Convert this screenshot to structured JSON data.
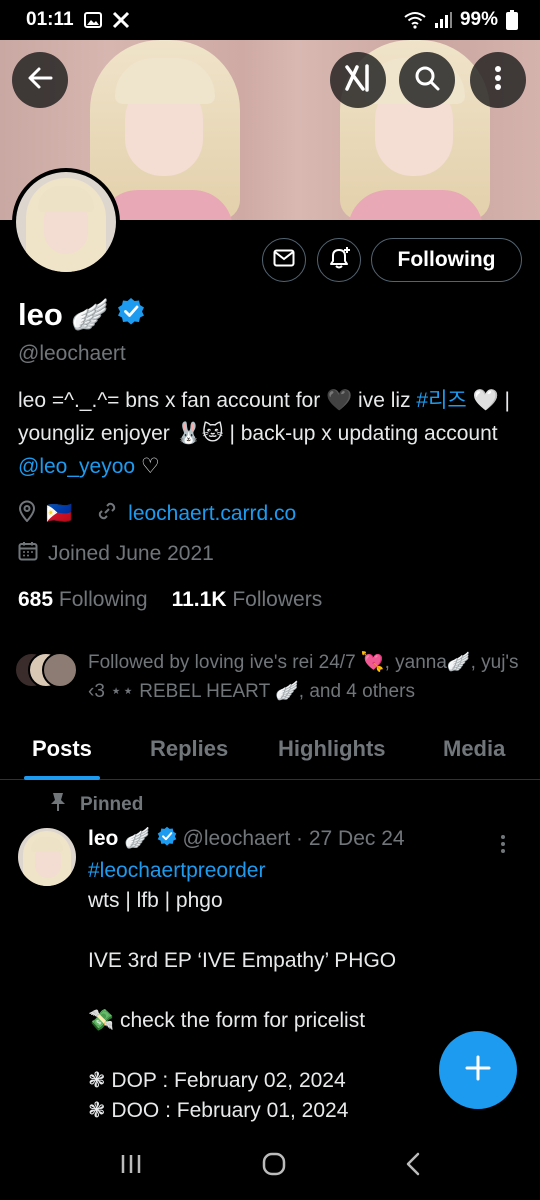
{
  "status_bar": {
    "time": "01:11",
    "battery": "99%"
  },
  "profile": {
    "name": "leo",
    "name_emoji": "🪽",
    "handle": "@leochaert",
    "bio_parts": {
      "p1": "leo =^._.^= bns x fan account for ",
      "heart_black": "🖤",
      "p2": " ive liz ",
      "hashtag": "#리즈",
      "p3": " 🤍 | youngliz enjoyer 🐰🐱 | back-up x updating account ",
      "mention": "@leo_yeyoo",
      "p4": " ♡"
    },
    "flag": "🇵🇭",
    "website": "leochaert.carrd.co",
    "joined": "Joined June 2021",
    "following_count": "685",
    "following_label": "Following",
    "followers_count": "11.1K",
    "followers_label": "Followers",
    "followed_by": "Followed by loving ive's rei 24/7 💘, yanna🪽, yuj's ‹3 ⋆⋆ REBEL HEART 🪽, and 4 others"
  },
  "actions": {
    "follow_label": "Following"
  },
  "tabs": [
    {
      "label": "Posts"
    },
    {
      "label": "Replies"
    },
    {
      "label": "Highlights"
    },
    {
      "label": "Media"
    }
  ],
  "pinned_tweet": {
    "pinned_label": "Pinned",
    "name": "leo",
    "name_emoji": "🪽",
    "handle_date": "@leochaert · 27 Dec 24",
    "hashtag": "#leochaertpreorder",
    "line1": "wts | lfb | phgo",
    "line2": "IVE 3rd EP ‘IVE Empathy’ PHGO",
    "line3": "💸 check the form for pricelist",
    "line4": "❃ DOP : February 02, 2024",
    "line5": "❃ DOO : February 01, 2024"
  },
  "colors": {
    "accent": "#1d9bf0",
    "muted": "#71767b",
    "text": "#e7e9ea",
    "border": "#2f3336"
  },
  "icons": [
    "back-arrow-icon",
    "grok-icon",
    "search-icon",
    "more-vertical-icon",
    "message-icon",
    "notification-bell-icon",
    "verified-badge-icon",
    "location-icon",
    "link-icon",
    "calendar-icon",
    "pin-icon",
    "compose-plus-icon"
  ]
}
